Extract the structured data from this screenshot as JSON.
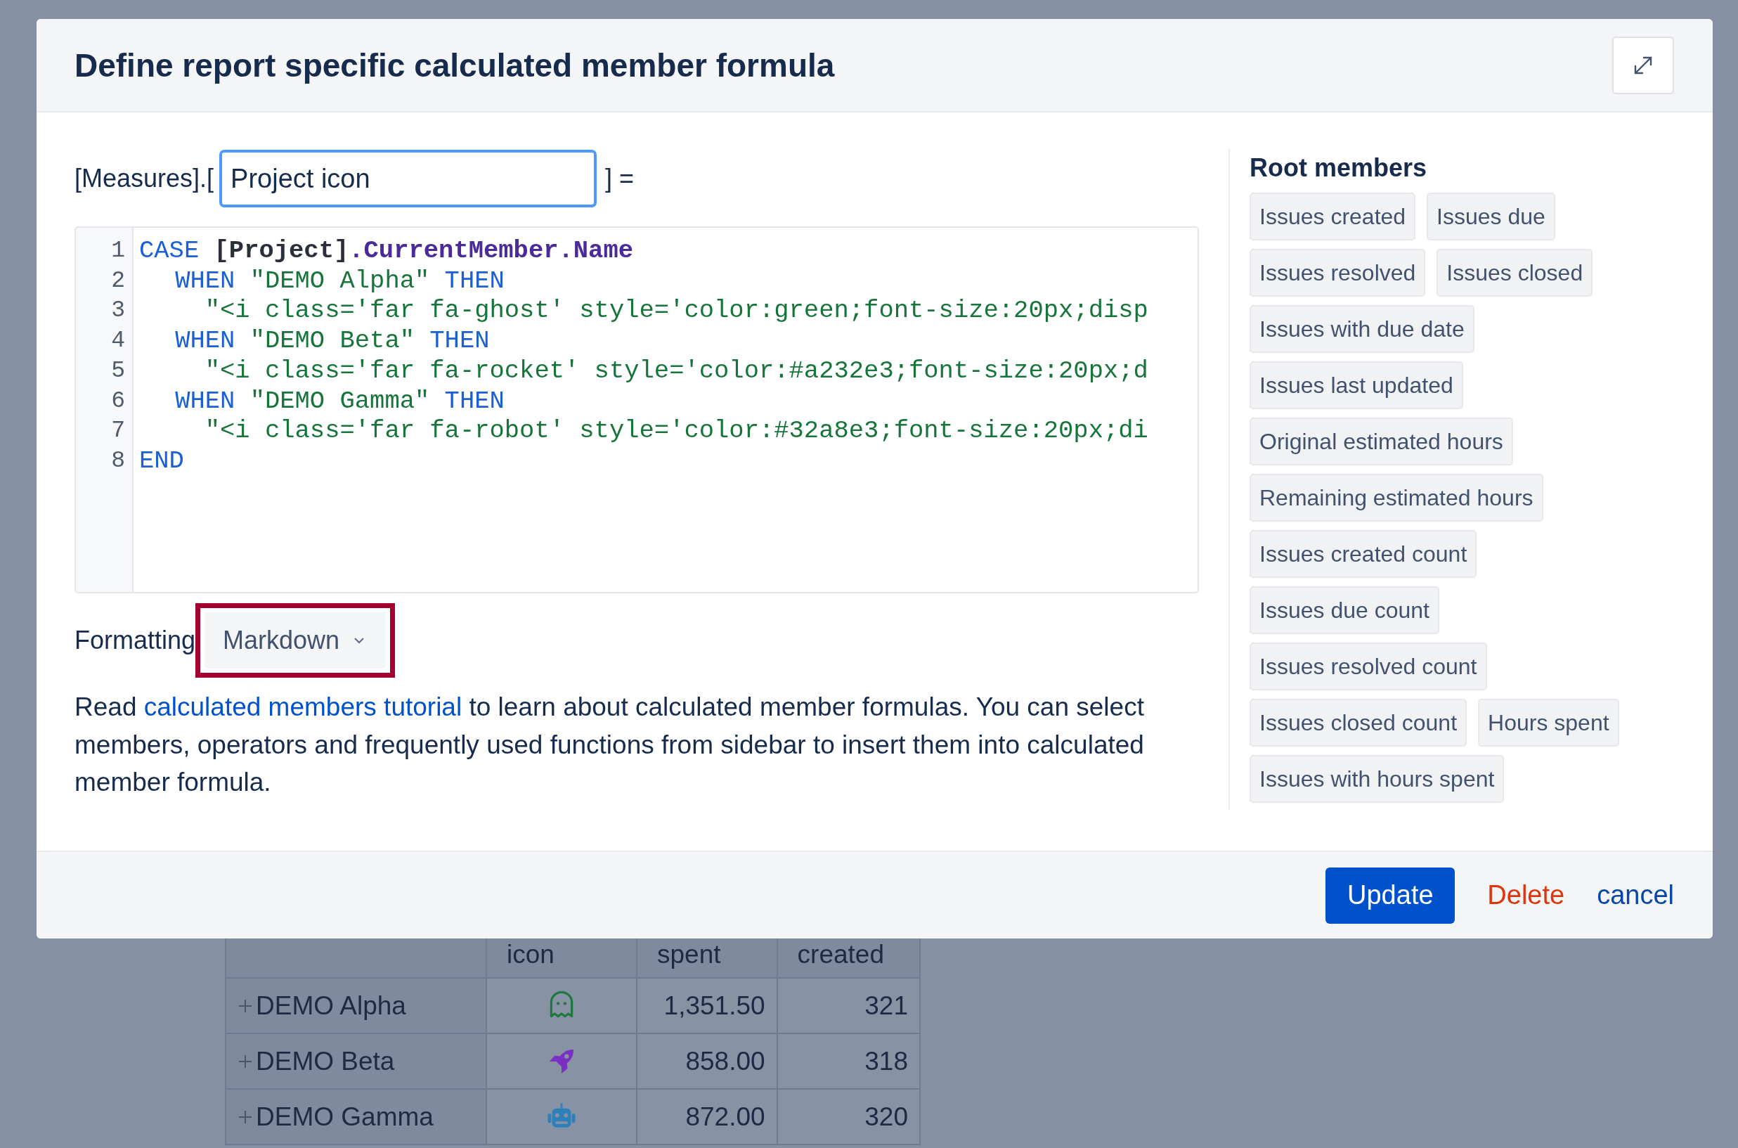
{
  "dialog": {
    "title": "Define report specific calculated member formula",
    "name_prefix": "[Measures].[",
    "name_value": "Project icon",
    "name_suffix": "] =",
    "code_lines": [
      {
        "number": "1",
        "kind": "case",
        "tokens": [
          {
            "kind": "keyword",
            "text": "CASE "
          },
          {
            "kind": "member",
            "text": "[Project]"
          },
          {
            "kind": "property",
            "text": ".CurrentMember.Name"
          }
        ]
      },
      {
        "number": "2",
        "kind": "when",
        "tokens": [
          {
            "kind": "keyword",
            "text": "WHEN "
          },
          {
            "kind": "string",
            "text": "\"DEMO Alpha\" "
          },
          {
            "kind": "keyword",
            "text": "THEN"
          }
        ]
      },
      {
        "number": "3",
        "kind": "value",
        "tokens": [
          {
            "kind": "string",
            "text": "\"<i class='far fa-ghost' style='color:green;font-size:20px;disp"
          }
        ]
      },
      {
        "number": "4",
        "kind": "when",
        "tokens": [
          {
            "kind": "keyword",
            "text": "WHEN "
          },
          {
            "kind": "string",
            "text": "\"DEMO Beta\" "
          },
          {
            "kind": "keyword",
            "text": "THEN"
          }
        ]
      },
      {
        "number": "5",
        "kind": "value",
        "tokens": [
          {
            "kind": "string",
            "text": "\"<i class='far fa-rocket' style='color:#a232e3;font-size:20px;d"
          }
        ]
      },
      {
        "number": "6",
        "kind": "when",
        "tokens": [
          {
            "kind": "keyword",
            "text": "WHEN "
          },
          {
            "kind": "string",
            "text": "\"DEMO Gamma\" "
          },
          {
            "kind": "keyword",
            "text": "THEN"
          }
        ]
      },
      {
        "number": "7",
        "kind": "value",
        "tokens": [
          {
            "kind": "string",
            "text": "\"<i class='far fa-robot' style='color:#32a8e3;font-size:20px;di"
          }
        ]
      },
      {
        "number": "8",
        "kind": "case",
        "tokens": [
          {
            "kind": "keyword",
            "text": "END"
          }
        ]
      }
    ],
    "formatting_label": "Formatting",
    "formatting_value": "Markdown",
    "formatting_highlighted": true,
    "help_before": "Read ",
    "help_link": "calculated members tutorial",
    "help_after": " to learn about calculated member formulas. You can select members, operators and frequently used functions from sidebar to insert them into calculated member formula.",
    "sidebar": {
      "title": "Root members",
      "items": [
        "Issues created",
        "Issues due",
        "Issues resolved",
        "Issues closed",
        "Issues with due date",
        "Issues last updated",
        "Original estimated hours",
        "Remaining estimated hours",
        "Issues created count",
        "Issues due count",
        "Issues resolved count",
        "Issues closed count",
        "Hours spent",
        "Issues with hours spent"
      ]
    },
    "buttons": {
      "update": "Update",
      "delete": "Delete",
      "cancel": "cancel"
    }
  },
  "background_table": {
    "columns": [
      "",
      "icon",
      "spent",
      "created"
    ],
    "rows": [
      {
        "name": "DEMO Alpha",
        "kind": "ghost",
        "color": "#1e7a3c",
        "spent": "1,351.50",
        "created": "321"
      },
      {
        "name": "DEMO Beta",
        "kind": "rocket",
        "color": "#7b2fc4",
        "spent": "858.00",
        "created": "318"
      },
      {
        "name": "DEMO Gamma",
        "kind": "robot",
        "color": "#2f7fba",
        "spent": "872.00",
        "created": "320"
      }
    ]
  }
}
